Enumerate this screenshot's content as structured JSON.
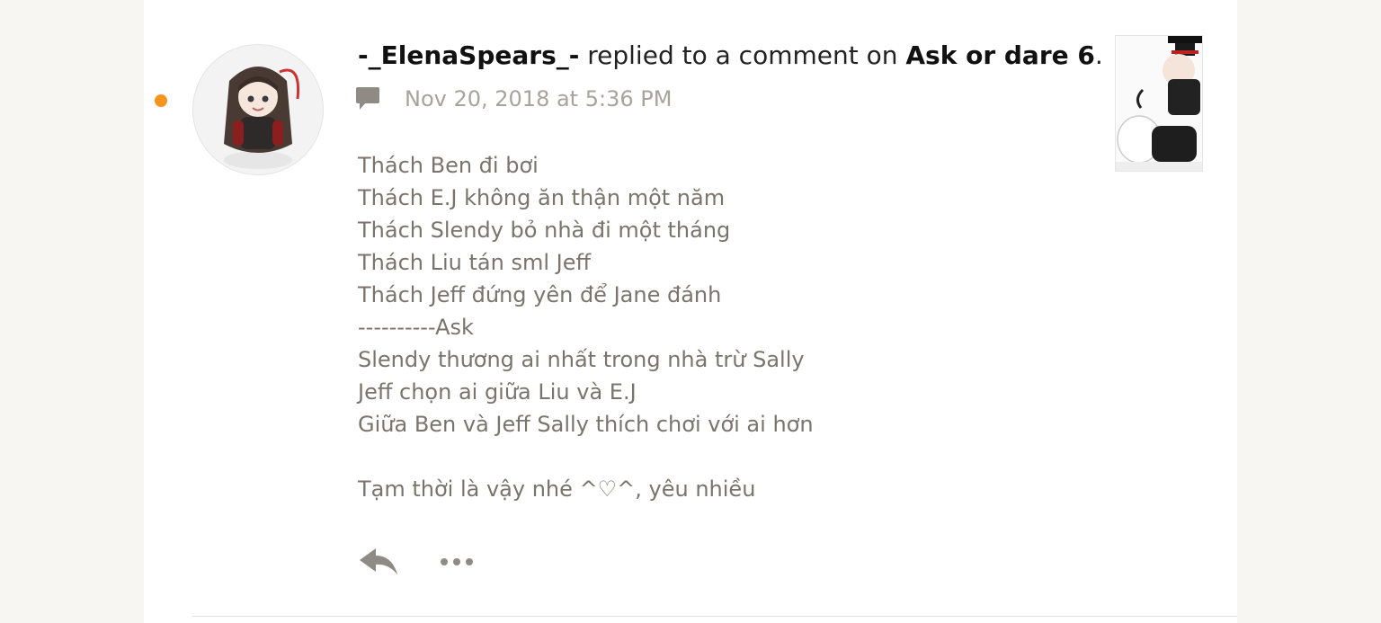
{
  "notification": {
    "username": "-_ElenaSpears_-",
    "action_text": " replied to a comment on ",
    "story_title": "Ask or dare 6",
    "end_punct": ".",
    "timestamp": "Nov 20, 2018 at 5:36 PM",
    "unread_color": "#f5951e",
    "body_lines": [
      "Thách Ben đi bơi",
      "Thách E.J không ăn thận một năm",
      "Thách Slendy bỏ nhà đi một tháng",
      "Thách Liu tán sml Jeff",
      "Thách Jeff đứng yên để Jane đánh",
      "----------Ask",
      "Slendy thương ai nhất trong nhà trừ Sally",
      "Jeff chọn ai giữa Liu và E.J",
      "Giữa Ben và Jeff Sally thích chơi với ai hơn",
      "",
      "Tạm thời là vậy nhé ^♡^, yêu nhiều"
    ],
    "icons": {
      "meta": "comment-icon",
      "reply": "reply-icon",
      "more": "more-options-icon"
    }
  }
}
